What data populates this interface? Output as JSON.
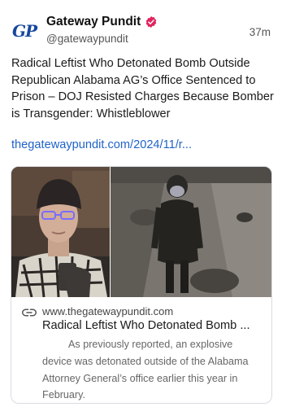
{
  "account": {
    "display_name": "Gateway Pundit",
    "handle": "@gatewaypundit",
    "avatar_text": "GP",
    "verified_icon": "verified-badge-icon",
    "time_ago": "37m"
  },
  "post": {
    "text": "Radical Leftist Who Detonated Bomb Outside Republican Alabama AG’s Office Sentenced to Prison – DOJ Resisted Charges Because Bomber is Transgender: Whistleblower",
    "link_text": "thegatewaypundit.com/2024/11/r..."
  },
  "card": {
    "link_icon": "link-icon",
    "domain": "www.thegatewaypundit.com",
    "title": "Radical Leftist Who Detonated Bomb ...",
    "description": "As previously reported, an explosive device was detonated outside of the Alabama Attorney General’s office earlier this year in February."
  },
  "colors": {
    "link": "#1f63c7",
    "verified": "#e0245e",
    "avatar_text": "#17479e"
  }
}
